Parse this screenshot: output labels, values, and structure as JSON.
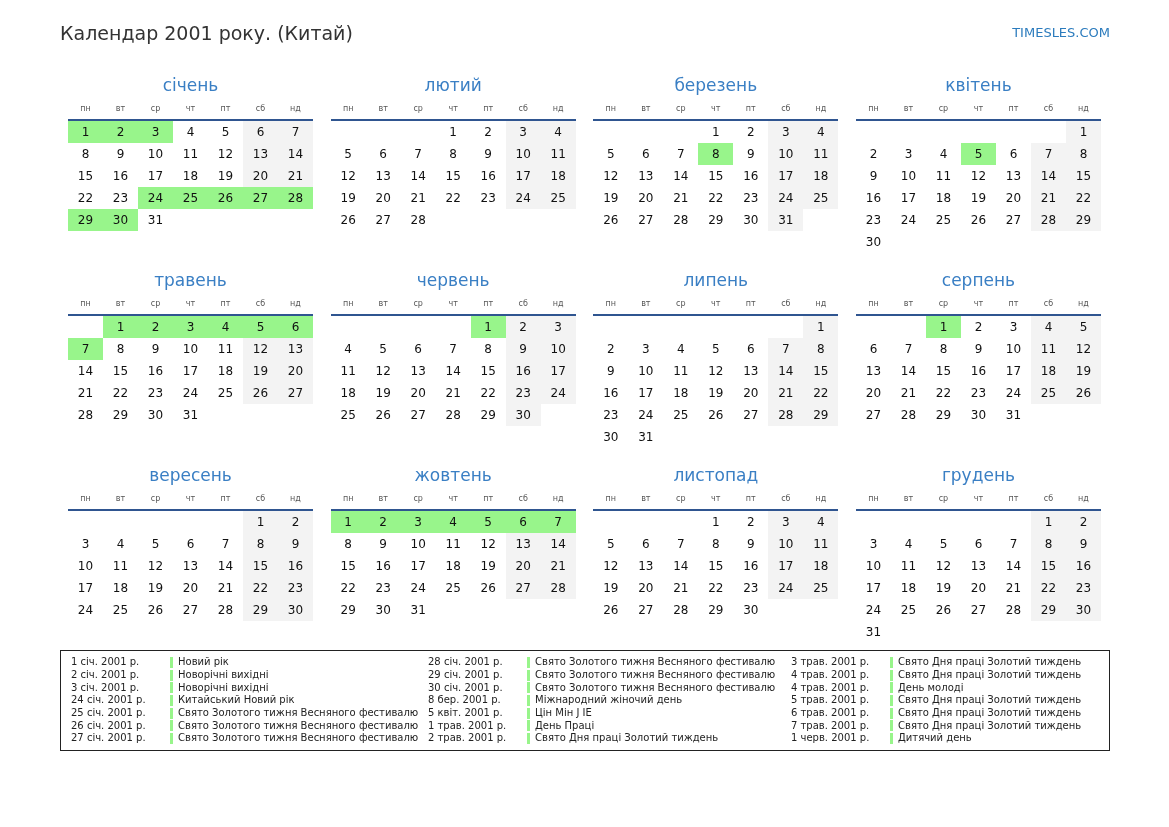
{
  "title": "Календар 2001 року. (Китай)",
  "site_link": "TIMESLES.COM",
  "months": [
    {
      "name": "січень",
      "weekdays": [
        {
          "label": "пн",
          "weekend": false
        },
        {
          "label": "вт",
          "weekend": false
        },
        {
          "label": "ср",
          "weekend": false
        },
        {
          "label": "чт",
          "weekend": false
        },
        {
          "label": "пт",
          "weekend": false
        },
        {
          "label": "сб",
          "weekend": true
        },
        {
          "label": "нд",
          "weekend": true
        }
      ],
      "weeks": [
        [
          {
            "day": "1",
            "holiday": true
          },
          {
            "day": "2",
            "holiday": true
          },
          {
            "day": "3",
            "holiday": true
          },
          {
            "day": "4",
            "holiday": false
          },
          {
            "day": "5",
            "holiday": false
          },
          {
            "day": "6",
            "holiday": false
          },
          {
            "day": "7",
            "holiday": false
          }
        ],
        [
          {
            "day": "8",
            "holiday": false
          },
          {
            "day": "9",
            "holiday": false
          },
          {
            "day": "10",
            "holiday": false
          },
          {
            "day": "11",
            "holiday": false
          },
          {
            "day": "12",
            "holiday": false
          },
          {
            "day": "13",
            "holiday": false
          },
          {
            "day": "14",
            "holiday": false
          }
        ],
        [
          {
            "day": "15",
            "holiday": false
          },
          {
            "day": "16",
            "holiday": false
          },
          {
            "day": "17",
            "holiday": false
          },
          {
            "day": "18",
            "holiday": false
          },
          {
            "day": "19",
            "holiday": false
          },
          {
            "day": "20",
            "holiday": false
          },
          {
            "day": "21",
            "holiday": false
          }
        ],
        [
          {
            "day": "22",
            "holiday": false
          },
          {
            "day": "23",
            "holiday": false
          },
          {
            "day": "24",
            "holiday": true
          },
          {
            "day": "25",
            "holiday": true
          },
          {
            "day": "26",
            "holiday": true
          },
          {
            "day": "27",
            "holiday": true
          },
          {
            "day": "28",
            "holiday": true
          }
        ],
        [
          {
            "day": "29",
            "holiday": true
          },
          {
            "day": "30",
            "holiday": true
          },
          {
            "day": "31",
            "holiday": false
          }
        ]
      ]
    },
    {
      "name": "лютий",
      "weekdays": [
        {
          "label": "пн",
          "weekend": false
        },
        {
          "label": "вт",
          "weekend": false
        },
        {
          "label": "ср",
          "weekend": false
        },
        {
          "label": "чт",
          "weekend": false
        },
        {
          "label": "пт",
          "weekend": false
        },
        {
          "label": "сб",
          "weekend": true
        },
        {
          "label": "нд",
          "weekend": true
        }
      ],
      "weeks": [
        [
          {
            "day": "1",
            "holiday": false
          },
          {
            "day": "2",
            "holiday": false
          },
          {
            "day": "3",
            "holiday": false
          },
          {
            "day": "4",
            "holiday": false
          }
        ],
        [
          {
            "day": "5",
            "holiday": false
          },
          {
            "day": "6",
            "holiday": false
          },
          {
            "day": "7",
            "holiday": false
          },
          {
            "day": "8",
            "holiday": false
          },
          {
            "day": "9",
            "holiday": false
          },
          {
            "day": "10",
            "holiday": false
          },
          {
            "day": "11",
            "holiday": false
          }
        ],
        [
          {
            "day": "12",
            "holiday": false
          },
          {
            "day": "13",
            "holiday": false
          },
          {
            "day": "14",
            "holiday": false
          },
          {
            "day": "15",
            "holiday": false
          },
          {
            "day": "16",
            "holiday": false
          },
          {
            "day": "17",
            "holiday": false
          },
          {
            "day": "18",
            "holiday": false
          }
        ],
        [
          {
            "day": "19",
            "holiday": false
          },
          {
            "day": "20",
            "holiday": false
          },
          {
            "day": "21",
            "holiday": false
          },
          {
            "day": "22",
            "holiday": false
          },
          {
            "day": "23",
            "holiday": false
          },
          {
            "day": "24",
            "holiday": false
          },
          {
            "day": "25",
            "holiday": false
          }
        ],
        [
          {
            "day": "26",
            "holiday": false
          },
          {
            "day": "27",
            "holiday": false
          },
          {
            "day": "28",
            "holiday": false
          }
        ]
      ]
    },
    {
      "name": "березень",
      "weekdays": [
        {
          "label": "пн",
          "weekend": false
        },
        {
          "label": "вт",
          "weekend": false
        },
        {
          "label": "ср",
          "weekend": false
        },
        {
          "label": "чт",
          "weekend": false
        },
        {
          "label": "пт",
          "weekend": false
        },
        {
          "label": "сб",
          "weekend": true
        },
        {
          "label": "нд",
          "weekend": true
        }
      ],
      "weeks": [
        [
          {
            "day": "1",
            "holiday": false
          },
          {
            "day": "2",
            "holiday": false
          },
          {
            "day": "3",
            "holiday": false
          },
          {
            "day": "4",
            "holiday": false
          }
        ],
        [
          {
            "day": "5",
            "holiday": false
          },
          {
            "day": "6",
            "holiday": false
          },
          {
            "day": "7",
            "holiday": false
          },
          {
            "day": "8",
            "holiday": true
          },
          {
            "day": "9",
            "holiday": false
          },
          {
            "day": "10",
            "holiday": false
          },
          {
            "day": "11",
            "holiday": false
          }
        ],
        [
          {
            "day": "12",
            "holiday": false
          },
          {
            "day": "13",
            "holiday": false
          },
          {
            "day": "14",
            "holiday": false
          },
          {
            "day": "15",
            "holiday": false
          },
          {
            "day": "16",
            "holiday": false
          },
          {
            "day": "17",
            "holiday": false
          },
          {
            "day": "18",
            "holiday": false
          }
        ],
        [
          {
            "day": "19",
            "holiday": false
          },
          {
            "day": "20",
            "holiday": false
          },
          {
            "day": "21",
            "holiday": false
          },
          {
            "day": "22",
            "holiday": false
          },
          {
            "day": "23",
            "holiday": false
          },
          {
            "day": "24",
            "holiday": false
          },
          {
            "day": "25",
            "holiday": false
          }
        ],
        [
          {
            "day": "26",
            "holiday": false
          },
          {
            "day": "27",
            "holiday": false
          },
          {
            "day": "28",
            "holiday": false
          },
          {
            "day": "29",
            "holiday": false
          },
          {
            "day": "30",
            "holiday": false
          },
          {
            "day": "31",
            "holiday": false
          }
        ]
      ]
    },
    {
      "name": "квітень",
      "weekdays": [
        {
          "label": "пн",
          "weekend": false
        },
        {
          "label": "вт",
          "weekend": false
        },
        {
          "label": "ср",
          "weekend": false
        },
        {
          "label": "чт",
          "weekend": false
        },
        {
          "label": "пт",
          "weekend": false
        },
        {
          "label": "сб",
          "weekend": true
        },
        {
          "label": "нд",
          "weekend": true
        }
      ],
      "weeks": [
        [
          {
            "day": "1",
            "holiday": false
          }
        ],
        [
          {
            "day": "2",
            "holiday": false
          },
          {
            "day": "3",
            "holiday": false
          },
          {
            "day": "4",
            "holiday": false
          },
          {
            "day": "5",
            "holiday": true
          },
          {
            "day": "6",
            "holiday": false
          },
          {
            "day": "7",
            "holiday": false
          },
          {
            "day": "8",
            "holiday": false
          }
        ],
        [
          {
            "day": "9",
            "holiday": false
          },
          {
            "day": "10",
            "holiday": false
          },
          {
            "day": "11",
            "holiday": false
          },
          {
            "day": "12",
            "holiday": false
          },
          {
            "day": "13",
            "holiday": false
          },
          {
            "day": "14",
            "holiday": false
          },
          {
            "day": "15",
            "holiday": false
          }
        ],
        [
          {
            "day": "16",
            "holiday": false
          },
          {
            "day": "17",
            "holiday": false
          },
          {
            "day": "18",
            "holiday": false
          },
          {
            "day": "19",
            "holiday": false
          },
          {
            "day": "20",
            "holiday": false
          },
          {
            "day": "21",
            "holiday": false
          },
          {
            "day": "22",
            "holiday": false
          }
        ],
        [
          {
            "day": "23",
            "holiday": false
          },
          {
            "day": "24",
            "holiday": false
          },
          {
            "day": "25",
            "holiday": false
          },
          {
            "day": "26",
            "holiday": false
          },
          {
            "day": "27",
            "holiday": false
          },
          {
            "day": "28",
            "holiday": false
          },
          {
            "day": "29",
            "holiday": false
          }
        ],
        [
          {
            "day": "30",
            "holiday": false
          }
        ]
      ]
    },
    {
      "name": "травень",
      "weekdays": [
        {
          "label": "пн",
          "weekend": false
        },
        {
          "label": "вт",
          "weekend": false
        },
        {
          "label": "ср",
          "weekend": false
        },
        {
          "label": "чт",
          "weekend": false
        },
        {
          "label": "пт",
          "weekend": false
        },
        {
          "label": "сб",
          "weekend": true
        },
        {
          "label": "нд",
          "weekend": true
        }
      ],
      "weeks": [
        [
          {
            "day": "1",
            "holiday": true
          },
          {
            "day": "2",
            "holiday": true
          },
          {
            "day": "3",
            "holiday": true
          },
          {
            "day": "4",
            "holiday": true
          },
          {
            "day": "5",
            "holiday": true
          },
          {
            "day": "6",
            "holiday": true
          }
        ],
        [
          {
            "day": "7",
            "holiday": true
          },
          {
            "day": "8",
            "holiday": false
          },
          {
            "day": "9",
            "holiday": false
          },
          {
            "day": "10",
            "holiday": false
          },
          {
            "day": "11",
            "holiday": false
          },
          {
            "day": "12",
            "holiday": false
          },
          {
            "day": "13",
            "holiday": false
          }
        ],
        [
          {
            "day": "14",
            "holiday": false
          },
          {
            "day": "15",
            "holiday": false
          },
          {
            "day": "16",
            "holiday": false
          },
          {
            "day": "17",
            "holiday": false
          },
          {
            "day": "18",
            "holiday": false
          },
          {
            "day": "19",
            "holiday": false
          },
          {
            "day": "20",
            "holiday": false
          }
        ],
        [
          {
            "day": "21",
            "holiday": false
          },
          {
            "day": "22",
            "holiday": false
          },
          {
            "day": "23",
            "holiday": false
          },
          {
            "day": "24",
            "holiday": false
          },
          {
            "day": "25",
            "holiday": false
          },
          {
            "day": "26",
            "holiday": false
          },
          {
            "day": "27",
            "holiday": false
          }
        ],
        [
          {
            "day": "28",
            "holiday": false
          },
          {
            "day": "29",
            "holiday": false
          },
          {
            "day": "30",
            "holiday": false
          },
          {
            "day": "31",
            "holiday": false
          }
        ]
      ]
    },
    {
      "name": "червень",
      "weekdays": [
        {
          "label": "пн",
          "weekend": false
        },
        {
          "label": "вт",
          "weekend": false
        },
        {
          "label": "ср",
          "weekend": false
        },
        {
          "label": "чт",
          "weekend": false
        },
        {
          "label": "пт",
          "weekend": false
        },
        {
          "label": "сб",
          "weekend": true
        },
        {
          "label": "нд",
          "weekend": true
        }
      ],
      "weeks": [
        [
          {
            "day": "1",
            "holiday": true
          },
          {
            "day": "2",
            "holiday": false
          },
          {
            "day": "3",
            "holiday": false
          }
        ],
        [
          {
            "day": "4",
            "holiday": false
          },
          {
            "day": "5",
            "holiday": false
          },
          {
            "day": "6",
            "holiday": false
          },
          {
            "day": "7",
            "holiday": false
          },
          {
            "day": "8",
            "holiday": false
          },
          {
            "day": "9",
            "holiday": false
          },
          {
            "day": "10",
            "holiday": false
          }
        ],
        [
          {
            "day": "11",
            "holiday": false
          },
          {
            "day": "12",
            "holiday": false
          },
          {
            "day": "13",
            "holiday": false
          },
          {
            "day": "14",
            "holiday": false
          },
          {
            "day": "15",
            "holiday": false
          },
          {
            "day": "16",
            "holiday": false
          },
          {
            "day": "17",
            "holiday": false
          }
        ],
        [
          {
            "day": "18",
            "holiday": false
          },
          {
            "day": "19",
            "holiday": false
          },
          {
            "day": "20",
            "holiday": false
          },
          {
            "day": "21",
            "holiday": false
          },
          {
            "day": "22",
            "holiday": false
          },
          {
            "day": "23",
            "holiday": false
          },
          {
            "day": "24",
            "holiday": false
          }
        ],
        [
          {
            "day": "25",
            "holiday": false
          },
          {
            "day": "26",
            "holiday": false
          },
          {
            "day": "27",
            "holiday": false
          },
          {
            "day": "28",
            "holiday": false
          },
          {
            "day": "29",
            "holiday": false
          },
          {
            "day": "30",
            "holiday": false
          }
        ]
      ]
    },
    {
      "name": "липень",
      "weekdays": [
        {
          "label": "пн",
          "weekend": false
        },
        {
          "label": "вт",
          "weekend": false
        },
        {
          "label": "ср",
          "weekend": false
        },
        {
          "label": "чт",
          "weekend": false
        },
        {
          "label": "пт",
          "weekend": false
        },
        {
          "label": "сб",
          "weekend": true
        },
        {
          "label": "нд",
          "weekend": true
        }
      ],
      "weeks": [
        [
          {
            "day": "1",
            "holiday": false
          }
        ],
        [
          {
            "day": "2",
            "holiday": false
          },
          {
            "day": "3",
            "holiday": false
          },
          {
            "day": "4",
            "holiday": false
          },
          {
            "day": "5",
            "holiday": false
          },
          {
            "day": "6",
            "holiday": false
          },
          {
            "day": "7",
            "holiday": false
          },
          {
            "day": "8",
            "holiday": false
          }
        ],
        [
          {
            "day": "9",
            "holiday": false
          },
          {
            "day": "10",
            "holiday": false
          },
          {
            "day": "11",
            "holiday": false
          },
          {
            "day": "12",
            "holiday": false
          },
          {
            "day": "13",
            "holiday": false
          },
          {
            "day": "14",
            "holiday": false
          },
          {
            "day": "15",
            "holiday": false
          }
        ],
        [
          {
            "day": "16",
            "holiday": false
          },
          {
            "day": "17",
            "holiday": false
          },
          {
            "day": "18",
            "holiday": false
          },
          {
            "day": "19",
            "holiday": false
          },
          {
            "day": "20",
            "holiday": false
          },
          {
            "day": "21",
            "holiday": false
          },
          {
            "day": "22",
            "holiday": false
          }
        ],
        [
          {
            "day": "23",
            "holiday": false
          },
          {
            "day": "24",
            "holiday": false
          },
          {
            "day": "25",
            "holiday": false
          },
          {
            "day": "26",
            "holiday": false
          },
          {
            "day": "27",
            "holiday": false
          },
          {
            "day": "28",
            "holiday": false
          },
          {
            "day": "29",
            "holiday": false
          }
        ],
        [
          {
            "day": "30",
            "holiday": false
          },
          {
            "day": "31",
            "holiday": false
          }
        ]
      ]
    },
    {
      "name": "серпень",
      "weekdays": [
        {
          "label": "пн",
          "weekend": false
        },
        {
          "label": "вт",
          "weekend": false
        },
        {
          "label": "ср",
          "weekend": false
        },
        {
          "label": "чт",
          "weekend": false
        },
        {
          "label": "пт",
          "weekend": false
        },
        {
          "label": "сб",
          "weekend": true
        },
        {
          "label": "нд",
          "weekend": true
        }
      ],
      "weeks": [
        [
          {
            "day": "1",
            "holiday": true
          },
          {
            "day": "2",
            "holiday": false
          },
          {
            "day": "3",
            "holiday": false
          },
          {
            "day": "4",
            "holiday": false
          },
          {
            "day": "5",
            "holiday": false
          }
        ],
        [
          {
            "day": "6",
            "holiday": false
          },
          {
            "day": "7",
            "holiday": false
          },
          {
            "day": "8",
            "holiday": false
          },
          {
            "day": "9",
            "holiday": false
          },
          {
            "day": "10",
            "holiday": false
          },
          {
            "day": "11",
            "holiday": false
          },
          {
            "day": "12",
            "holiday": false
          }
        ],
        [
          {
            "day": "13",
            "holiday": false
          },
          {
            "day": "14",
            "holiday": false
          },
          {
            "day": "15",
            "holiday": false
          },
          {
            "day": "16",
            "holiday": false
          },
          {
            "day": "17",
            "holiday": false
          },
          {
            "day": "18",
            "holiday": false
          },
          {
            "day": "19",
            "holiday": false
          }
        ],
        [
          {
            "day": "20",
            "holiday": false
          },
          {
            "day": "21",
            "holiday": false
          },
          {
            "day": "22",
            "holiday": false
          },
          {
            "day": "23",
            "holiday": false
          },
          {
            "day": "24",
            "holiday": false
          },
          {
            "day": "25",
            "holiday": false
          },
          {
            "day": "26",
            "holiday": false
          }
        ],
        [
          {
            "day": "27",
            "holiday": false
          },
          {
            "day": "28",
            "holiday": false
          },
          {
            "day": "29",
            "holiday": false
          },
          {
            "day": "30",
            "holiday": false
          },
          {
            "day": "31",
            "holiday": false
          }
        ]
      ]
    },
    {
      "name": "вересень",
      "weekdays": [
        {
          "label": "пн",
          "weekend": false
        },
        {
          "label": "вт",
          "weekend": false
        },
        {
          "label": "ср",
          "weekend": false
        },
        {
          "label": "чт",
          "weekend": false
        },
        {
          "label": "пт",
          "weekend": false
        },
        {
          "label": "сб",
          "weekend": true
        },
        {
          "label": "нд",
          "weekend": true
        }
      ],
      "weeks": [
        [
          {
            "day": "1",
            "holiday": false
          },
          {
            "day": "2",
            "holiday": false
          }
        ],
        [
          {
            "day": "3",
            "holiday": false
          },
          {
            "day": "4",
            "holiday": false
          },
          {
            "day": "5",
            "holiday": false
          },
          {
            "day": "6",
            "holiday": false
          },
          {
            "day": "7",
            "holiday": false
          },
          {
            "day": "8",
            "holiday": false
          },
          {
            "day": "9",
            "holiday": false
          }
        ],
        [
          {
            "day": "10",
            "holiday": false
          },
          {
            "day": "11",
            "holiday": false
          },
          {
            "day": "12",
            "holiday": false
          },
          {
            "day": "13",
            "holiday": false
          },
          {
            "day": "14",
            "holiday": false
          },
          {
            "day": "15",
            "holiday": false
          },
          {
            "day": "16",
            "holiday": false
          }
        ],
        [
          {
            "day": "17",
            "holiday": false
          },
          {
            "day": "18",
            "holiday": false
          },
          {
            "day": "19",
            "holiday": false
          },
          {
            "day": "20",
            "holiday": false
          },
          {
            "day": "21",
            "holiday": false
          },
          {
            "day": "22",
            "holiday": false
          },
          {
            "day": "23",
            "holiday": false
          }
        ],
        [
          {
            "day": "24",
            "holiday": false
          },
          {
            "day": "25",
            "holiday": false
          },
          {
            "day": "26",
            "holiday": false
          },
          {
            "day": "27",
            "holiday": false
          },
          {
            "day": "28",
            "holiday": false
          },
          {
            "day": "29",
            "holiday": false
          },
          {
            "day": "30",
            "holiday": false
          }
        ]
      ]
    },
    {
      "name": "жовтень",
      "weekdays": [
        {
          "label": "пн",
          "weekend": false
        },
        {
          "label": "вт",
          "weekend": false
        },
        {
          "label": "ср",
          "weekend": false
        },
        {
          "label": "чт",
          "weekend": false
        },
        {
          "label": "пт",
          "weekend": false
        },
        {
          "label": "сб",
          "weekend": true
        },
        {
          "label": "нд",
          "weekend": true
        }
      ],
      "weeks": [
        [
          {
            "day": "1",
            "holiday": true
          },
          {
            "day": "2",
            "holiday": true
          },
          {
            "day": "3",
            "holiday": true
          },
          {
            "day": "4",
            "holiday": true
          },
          {
            "day": "5",
            "holiday": true
          },
          {
            "day": "6",
            "holiday": true
          },
          {
            "day": "7",
            "holiday": true
          }
        ],
        [
          {
            "day": "8",
            "holiday": false
          },
          {
            "day": "9",
            "holiday": false
          },
          {
            "day": "10",
            "holiday": false
          },
          {
            "day": "11",
            "holiday": false
          },
          {
            "day": "12",
            "holiday": false
          },
          {
            "day": "13",
            "holiday": false
          },
          {
            "day": "14",
            "holiday": false
          }
        ],
        [
          {
            "day": "15",
            "holiday": false
          },
          {
            "day": "16",
            "holiday": false
          },
          {
            "day": "17",
            "holiday": false
          },
          {
            "day": "18",
            "holiday": false
          },
          {
            "day": "19",
            "holiday": false
          },
          {
            "day": "20",
            "holiday": false
          },
          {
            "day": "21",
            "holiday": false
          }
        ],
        [
          {
            "day": "22",
            "holiday": false
          },
          {
            "day": "23",
            "holiday": false
          },
          {
            "day": "24",
            "holiday": false
          },
          {
            "day": "25",
            "holiday": false
          },
          {
            "day": "26",
            "holiday": false
          },
          {
            "day": "27",
            "holiday": false
          },
          {
            "day": "28",
            "holiday": false
          }
        ],
        [
          {
            "day": "29",
            "holiday": false
          },
          {
            "day": "30",
            "holiday": false
          },
          {
            "day": "31",
            "holiday": false
          }
        ]
      ]
    },
    {
      "name": "листопад",
      "weekdays": [
        {
          "label": "пн",
          "weekend": false
        },
        {
          "label": "вт",
          "weekend": false
        },
        {
          "label": "ср",
          "weekend": false
        },
        {
          "label": "чт",
          "weekend": false
        },
        {
          "label": "пт",
          "weekend": false
        },
        {
          "label": "сб",
          "weekend": true
        },
        {
          "label": "нд",
          "weekend": true
        }
      ],
      "weeks": [
        [
          {
            "day": "1",
            "holiday": false
          },
          {
            "day": "2",
            "holiday": false
          },
          {
            "day": "3",
            "holiday": false
          },
          {
            "day": "4",
            "holiday": false
          }
        ],
        [
          {
            "day": "5",
            "holiday": false
          },
          {
            "day": "6",
            "holiday": false
          },
          {
            "day": "7",
            "holiday": false
          },
          {
            "day": "8",
            "holiday": false
          },
          {
            "day": "9",
            "holiday": false
          },
          {
            "day": "10",
            "holiday": false
          },
          {
            "day": "11",
            "holiday": false
          }
        ],
        [
          {
            "day": "12",
            "holiday": false
          },
          {
            "day": "13",
            "holiday": false
          },
          {
            "day": "14",
            "holiday": false
          },
          {
            "day": "15",
            "holiday": false
          },
          {
            "day": "16",
            "holiday": false
          },
          {
            "day": "17",
            "holiday": false
          },
          {
            "day": "18",
            "holiday": false
          }
        ],
        [
          {
            "day": "19",
            "holiday": false
          },
          {
            "day": "20",
            "holiday": false
          },
          {
            "day": "21",
            "holiday": false
          },
          {
            "day": "22",
            "holiday": false
          },
          {
            "day": "23",
            "holiday": false
          },
          {
            "day": "24",
            "holiday": false
          },
          {
            "day": "25",
            "holiday": false
          }
        ],
        [
          {
            "day": "26",
            "holiday": false
          },
          {
            "day": "27",
            "holiday": false
          },
          {
            "day": "28",
            "holiday": false
          },
          {
            "day": "29",
            "holiday": false
          },
          {
            "day": "30",
            "holiday": false
          }
        ]
      ]
    },
    {
      "name": "грудень",
      "weekdays": [
        {
          "label": "пн",
          "weekend": false
        },
        {
          "label": "вт",
          "weekend": false
        },
        {
          "label": "ср",
          "weekend": false
        },
        {
          "label": "чт",
          "weekend": false
        },
        {
          "label": "пт",
          "weekend": false
        },
        {
          "label": "сб",
          "weekend": true
        },
        {
          "label": "нд",
          "weekend": true
        }
      ],
      "weeks": [
        [
          {
            "day": "1",
            "holiday": false
          },
          {
            "day": "2",
            "holiday": false
          }
        ],
        [
          {
            "day": "3",
            "holiday": false
          },
          {
            "day": "4",
            "holiday": false
          },
          {
            "day": "5",
            "holiday": false
          },
          {
            "day": "6",
            "holiday": false
          },
          {
            "day": "7",
            "holiday": false
          },
          {
            "day": "8",
            "holiday": false
          },
          {
            "day": "9",
            "holiday": false
          }
        ],
        [
          {
            "day": "10",
            "holiday": false
          },
          {
            "day": "11",
            "holiday": false
          },
          {
            "day": "12",
            "holiday": false
          },
          {
            "day": "13",
            "holiday": false
          },
          {
            "day": "14",
            "holiday": false
          },
          {
            "day": "15",
            "holiday": false
          },
          {
            "day": "16",
            "holiday": false
          }
        ],
        [
          {
            "day": "17",
            "holiday": false
          },
          {
            "day": "18",
            "holiday": false
          },
          {
            "day": "19",
            "holiday": false
          },
          {
            "day": "20",
            "holiday": false
          },
          {
            "day": "21",
            "holiday": false
          },
          {
            "day": "22",
            "holiday": false
          },
          {
            "day": "23",
            "holiday": false
          }
        ],
        [
          {
            "day": "24",
            "holiday": false
          },
          {
            "day": "25",
            "holiday": false
          },
          {
            "day": "26",
            "holiday": false
          },
          {
            "day": "27",
            "holiday": false
          },
          {
            "day": "28",
            "holiday": false
          },
          {
            "day": "29",
            "holiday": false
          },
          {
            "day": "30",
            "holiday": false
          }
        ],
        [
          {
            "day": "31",
            "holiday": false
          }
        ]
      ]
    }
  ],
  "legend": {
    "columns": [
      [
        {
          "date": "1 січ. 2001 р.",
          "name": "Новий рік"
        },
        {
          "date": "2 січ. 2001 р.",
          "name": "Новорічні вихідні"
        },
        {
          "date": "3 січ. 2001 р.",
          "name": "Новорічні вихідні"
        },
        {
          "date": "24 січ. 2001 р.",
          "name": "Китайський Новий рік"
        },
        {
          "date": "25 січ. 2001 р.",
          "name": "Свято Золотого тижня Весняного фестивалю"
        },
        {
          "date": "26 січ. 2001 р.",
          "name": "Свято Золотого тижня Весняного фестивалю"
        },
        {
          "date": "27 січ. 2001 р.",
          "name": "Свято Золотого тижня Весняного фестивалю"
        }
      ],
      [
        {
          "date": "28 січ. 2001 р.",
          "name": "Свято Золотого тижня Весняного фестивалю"
        },
        {
          "date": "29 січ. 2001 р.",
          "name": "Свято Золотого тижня Весняного фестивалю"
        },
        {
          "date": "30 січ. 2001 р.",
          "name": "Свято Золотого тижня Весняного фестивалю"
        },
        {
          "date": "8 бер. 2001 р.",
          "name": "Міжнародний жіночий день"
        },
        {
          "date": "5 квіт. 2001 р.",
          "name": "Цін Мін J IE"
        },
        {
          "date": "1 трав. 2001 р.",
          "name": "День Праці"
        },
        {
          "date": "2 трав. 2001 р.",
          "name": "Свято Дня праці Золотий тиждень"
        }
      ],
      [
        {
          "date": "3 трав. 2001 р.",
          "name": "Свято Дня праці Золотий тиждень"
        },
        {
          "date": "4 трав. 2001 р.",
          "name": "Свято Дня праці Золотий тиждень"
        },
        {
          "date": "4 трав. 2001 р.",
          "name": "День молоді"
        },
        {
          "date": "5 трав. 2001 р.",
          "name": "Свято Дня праці Золотий тиждень"
        },
        {
          "date": "6 трав. 2001 р.",
          "name": "Свято Дня праці Золотий тиждень"
        },
        {
          "date": "7 трав. 2001 р.",
          "name": "Свято Дня праці Золотий тиждень"
        },
        {
          "date": "1 черв. 2001 р.",
          "name": "Дитячий день"
        }
      ]
    ]
  }
}
